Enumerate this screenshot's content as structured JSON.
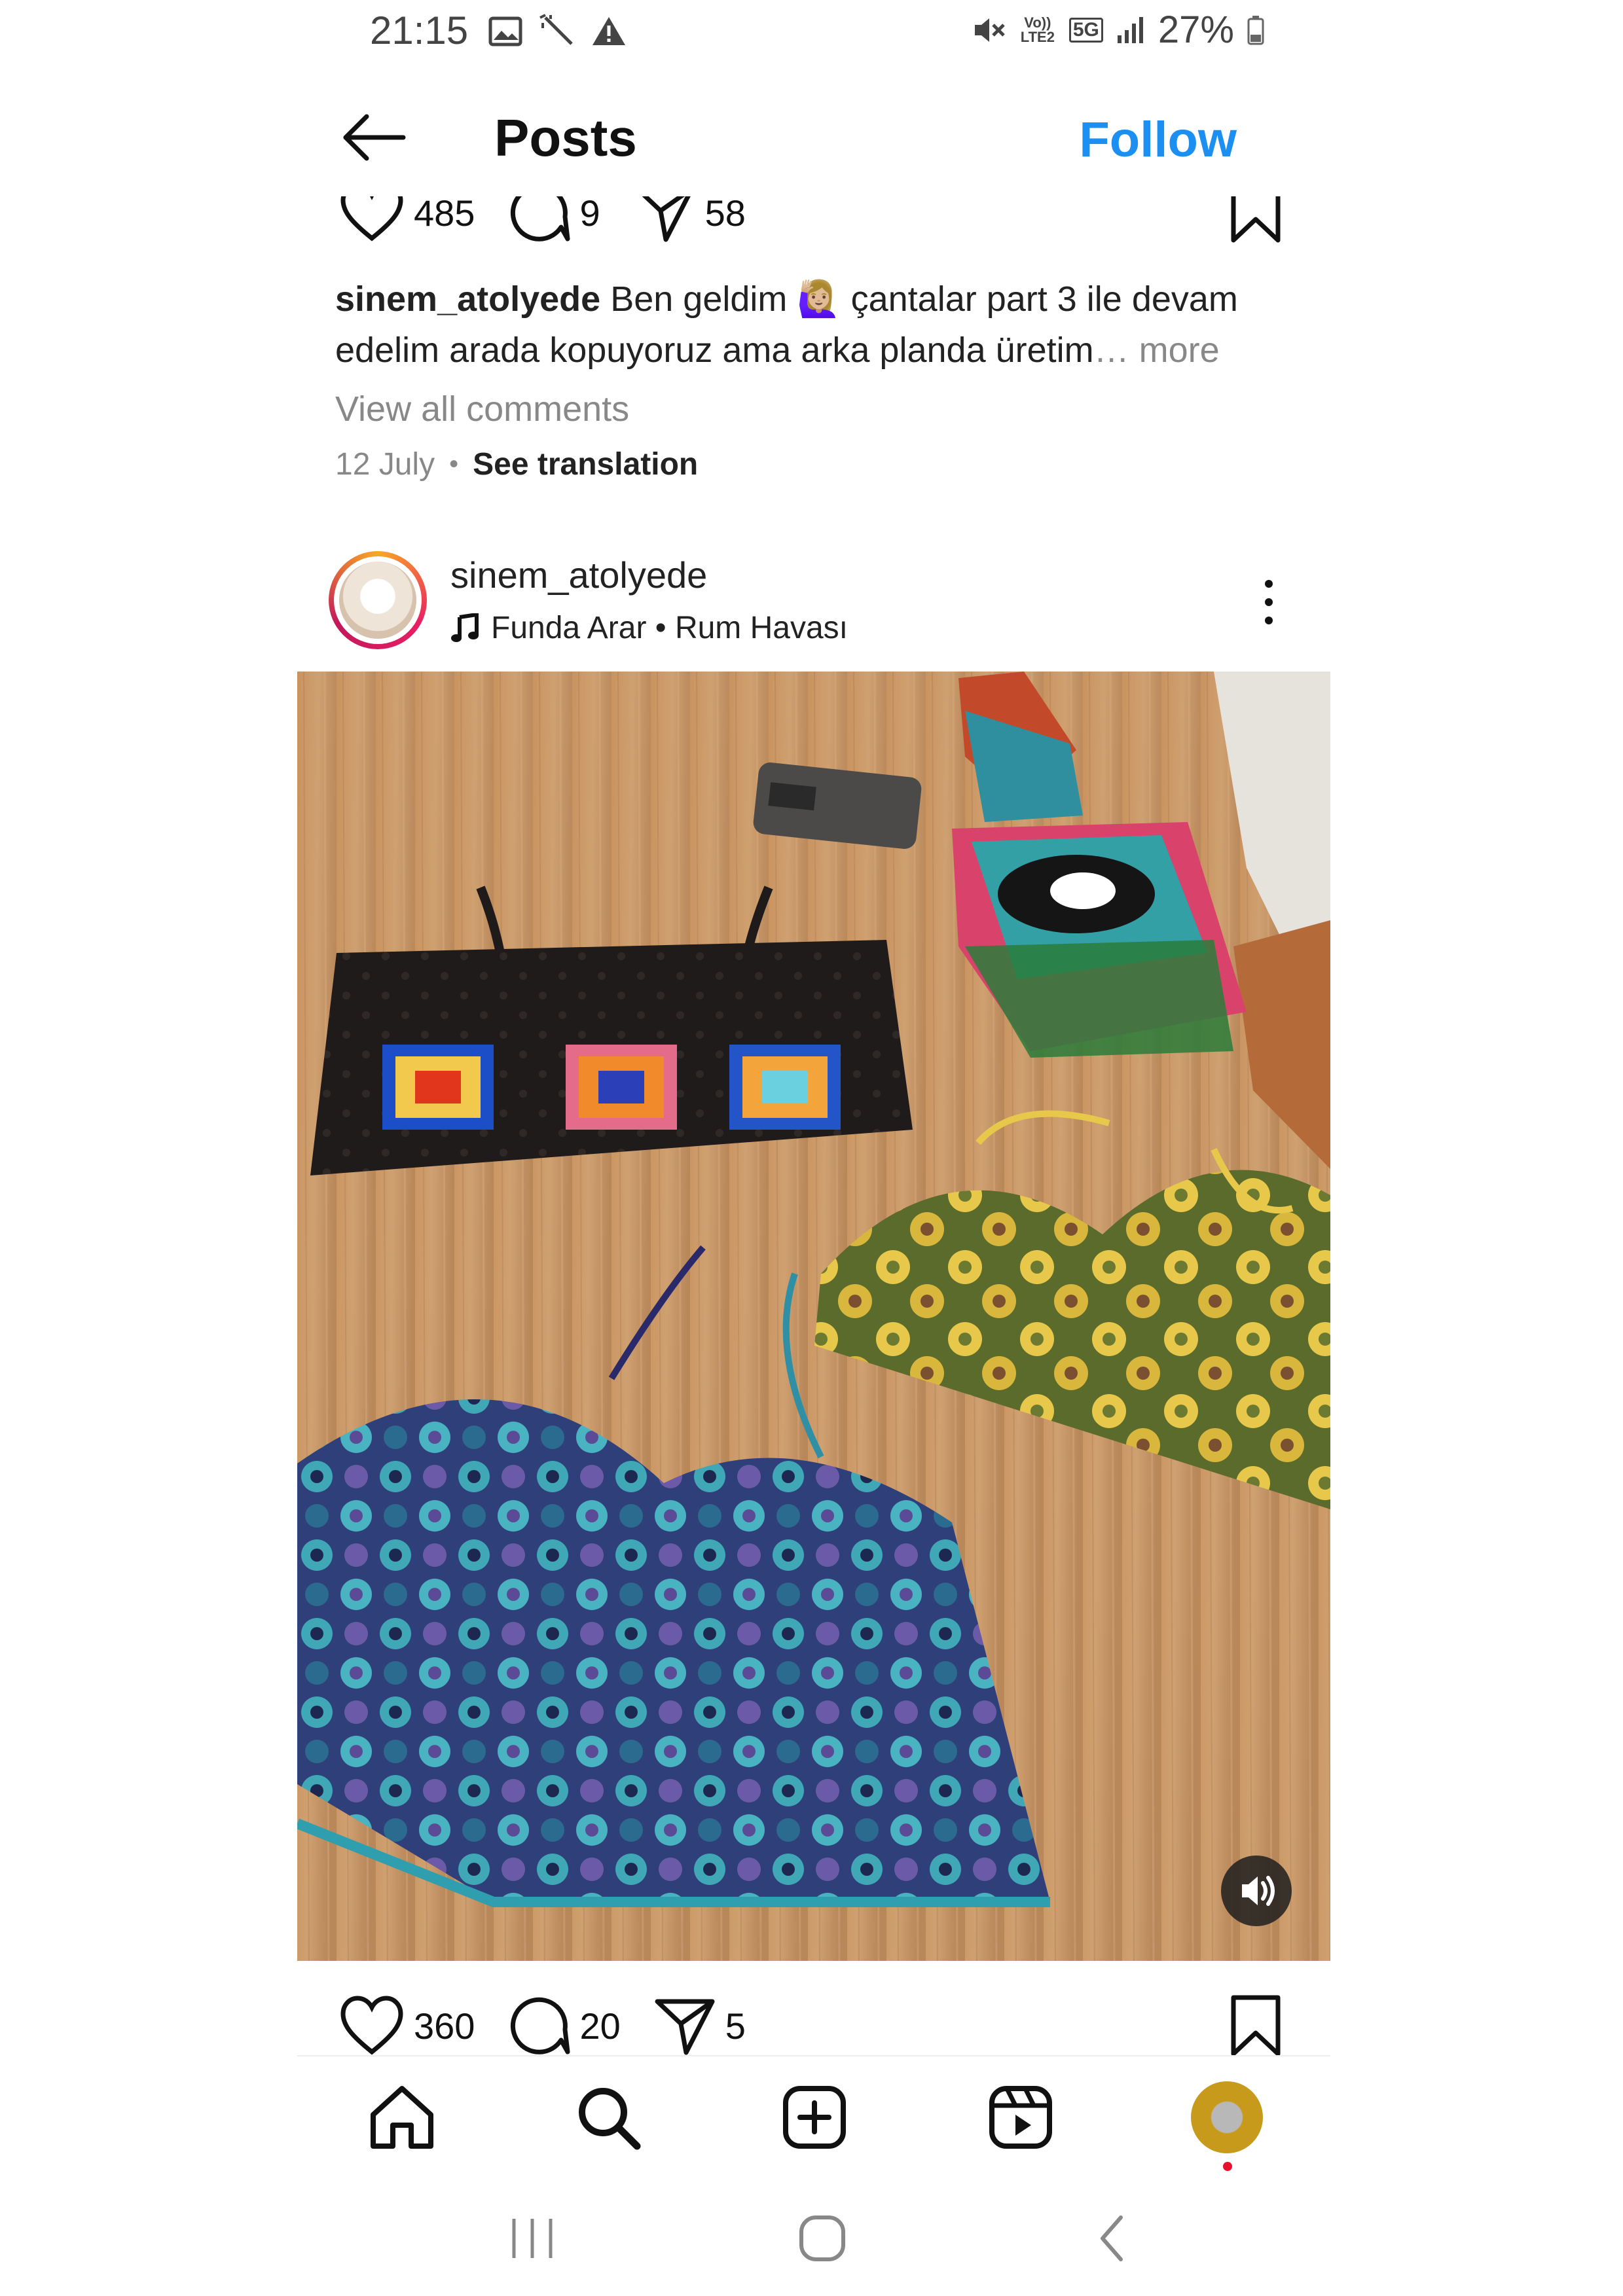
{
  "status_bar": {
    "time": "21:15",
    "left_icons": [
      "image-icon",
      "magic-wand-icon",
      "warning-icon"
    ],
    "right_icons": [
      "mute-icon",
      "volte-icon",
      "5g-icon",
      "signal-icon",
      "battery-icon"
    ],
    "volte_label": "Vo)) LTE2",
    "network_label": "5G",
    "battery": "27%"
  },
  "header": {
    "title": "Posts",
    "follow_label": "Follow"
  },
  "previous_post": {
    "likes": "485",
    "comments": "9",
    "shares": "58",
    "username": "sinem_atolyede",
    "caption_line1": "Ben geldim 🙋🏼‍♀️ çantalar part 3 ile devam",
    "caption_line2": "edelim arada kopuyoruz ama arka planda üretim",
    "ellipsis": "…",
    "more_label": "more",
    "view_comments": "View all comments",
    "date": "12 July",
    "separator": "•",
    "see_translation": "See translation"
  },
  "post": {
    "username": "sinem_atolyede",
    "audio": "Funda Arar • Rum Havası",
    "likes": "360",
    "comments": "20",
    "shares": "5"
  },
  "colors": {
    "follow": "#1b8ff2",
    "text": "#222222",
    "muted": "#888888",
    "wood": "#c89a6a"
  },
  "bottom_nav": [
    "home-icon",
    "search-icon",
    "create-icon",
    "reels-icon",
    "profile-avatar"
  ]
}
